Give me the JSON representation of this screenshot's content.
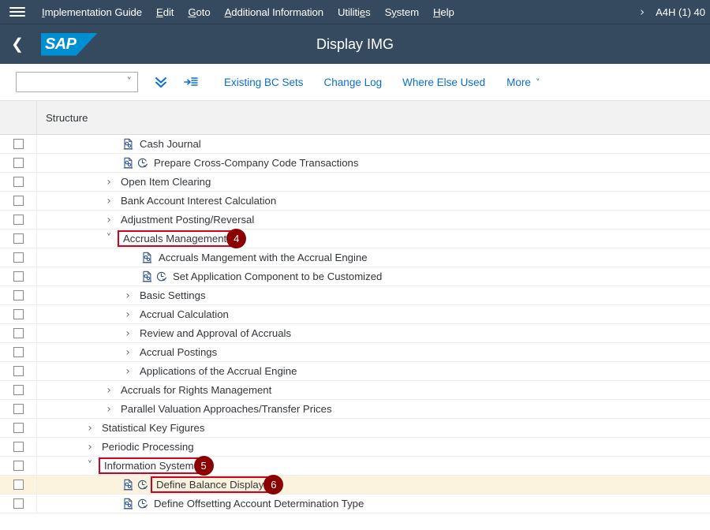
{
  "menubar": {
    "hamburger_icon": "hamburger-menu-icon",
    "items": [
      {
        "label": "Implementation Guide",
        "mnemonic": "I"
      },
      {
        "label": "Edit",
        "mnemonic": "E"
      },
      {
        "label": "Goto",
        "mnemonic": "G"
      },
      {
        "label": "Additional Information",
        "mnemonic": "A"
      },
      {
        "label": "Utilities",
        "mnemonic": "e"
      },
      {
        "label": "System",
        "mnemonic": "y"
      },
      {
        "label": "Help",
        "mnemonic": "H"
      }
    ],
    "overflow_icon": "chevron-right-icon",
    "system_info": "A4H (1) 40"
  },
  "shellbar": {
    "back_icon": "chevron-left-icon",
    "logo_text": "SAP",
    "title": "Display IMG"
  },
  "toolbar": {
    "combo_value": "",
    "combo_chevron_icon": "chevron-down-icon",
    "collapse_all_icon": "double-chevron-down-icon",
    "expand_node_icon": "indent-list-icon",
    "buttons": [
      "Existing BC Sets",
      "Change Log",
      "Where Else Used"
    ],
    "more_label": "More",
    "more_chevron_icon": "chevron-down-icon"
  },
  "table": {
    "column_header": "Structure",
    "rows": [
      {
        "label": "Cash Journal",
        "indent": 4,
        "expander": "",
        "icons": [
          "doc"
        ],
        "selected": false,
        "boxed": false,
        "badge": ""
      },
      {
        "label": "Prepare Cross-Company Code Transactions",
        "indent": 4,
        "expander": "",
        "icons": [
          "doc",
          "clock"
        ],
        "selected": false,
        "boxed": false,
        "badge": ""
      },
      {
        "label": "Open Item Clearing",
        "indent": 3,
        "expander": "collapsed",
        "icons": [],
        "selected": false,
        "boxed": false,
        "badge": ""
      },
      {
        "label": "Bank Account Interest Calculation",
        "indent": 3,
        "expander": "collapsed",
        "icons": [],
        "selected": false,
        "boxed": false,
        "badge": ""
      },
      {
        "label": "Adjustment Posting/Reversal",
        "indent": 3,
        "expander": "collapsed",
        "icons": [],
        "selected": false,
        "boxed": false,
        "badge": ""
      },
      {
        "label": "Accruals Management",
        "indent": 3,
        "expander": "expanded",
        "icons": [],
        "selected": false,
        "boxed": true,
        "badge": "4"
      },
      {
        "label": "Accruals Mangement with the Accrual Engine",
        "indent": 5,
        "expander": "",
        "icons": [
          "doc"
        ],
        "selected": false,
        "boxed": false,
        "badge": ""
      },
      {
        "label": "Set Application Component to be Customized",
        "indent": 5,
        "expander": "",
        "icons": [
          "doc",
          "clock"
        ],
        "selected": false,
        "boxed": false,
        "badge": ""
      },
      {
        "label": "Basic Settings",
        "indent": 4,
        "expander": "collapsed",
        "icons": [],
        "selected": false,
        "boxed": false,
        "badge": ""
      },
      {
        "label": "Accrual Calculation",
        "indent": 4,
        "expander": "collapsed",
        "icons": [],
        "selected": false,
        "boxed": false,
        "badge": ""
      },
      {
        "label": "Review and Approval of Accruals",
        "indent": 4,
        "expander": "collapsed",
        "icons": [],
        "selected": false,
        "boxed": false,
        "badge": ""
      },
      {
        "label": "Accrual Postings",
        "indent": 4,
        "expander": "collapsed",
        "icons": [],
        "selected": false,
        "boxed": false,
        "badge": ""
      },
      {
        "label": "Applications of the Accrual Engine",
        "indent": 4,
        "expander": "collapsed",
        "icons": [],
        "selected": false,
        "boxed": false,
        "badge": ""
      },
      {
        "label": "Accruals for Rights Management",
        "indent": 3,
        "expander": "collapsed",
        "icons": [],
        "selected": false,
        "boxed": false,
        "badge": ""
      },
      {
        "label": "Parallel Valuation Approaches/Transfer Prices",
        "indent": 3,
        "expander": "collapsed",
        "icons": [],
        "selected": false,
        "boxed": false,
        "badge": ""
      },
      {
        "label": "Statistical Key Figures",
        "indent": 2,
        "expander": "collapsed",
        "icons": [],
        "selected": false,
        "boxed": false,
        "badge": ""
      },
      {
        "label": "Periodic Processing",
        "indent": 2,
        "expander": "collapsed",
        "icons": [],
        "selected": false,
        "boxed": false,
        "badge": ""
      },
      {
        "label": "Information System",
        "indent": 2,
        "expander": "expanded",
        "icons": [],
        "selected": false,
        "boxed": true,
        "badge": "5"
      },
      {
        "label": "Define Balance Display",
        "indent": 4,
        "expander": "",
        "icons": [
          "doc",
          "clock"
        ],
        "selected": true,
        "boxed": true,
        "badge": "6"
      },
      {
        "label": "Define Offsetting Account Determination Type",
        "indent": 4,
        "expander": "",
        "icons": [
          "doc",
          "clock"
        ],
        "selected": false,
        "boxed": false,
        "badge": ""
      }
    ]
  },
  "colors": {
    "shell_bg": "#354a5f",
    "accent_blue": "#0a6ed1",
    "sap_logo_blue": "#008fd3",
    "annotation_red": "#d0011b",
    "badge_dark_red": "#8b0000",
    "selected_row": "#fbf3de"
  }
}
